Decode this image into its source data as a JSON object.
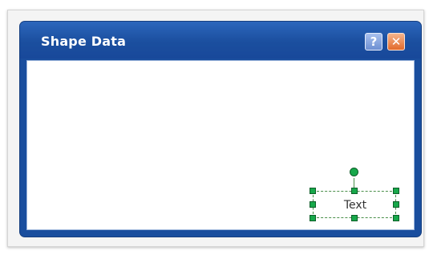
{
  "window": {
    "title": "Shape Data",
    "help_label": "?",
    "close_label": "✕"
  },
  "shape": {
    "text": "Text"
  },
  "colors": {
    "titlebar": "#1b4f9f",
    "close_button": "#e26a2c",
    "help_button": "#6c8fd2",
    "selection_handle": "#17a84a"
  },
  "icons": {
    "help": "help-icon",
    "close": "close-icon",
    "rotate": "rotation-handle"
  }
}
